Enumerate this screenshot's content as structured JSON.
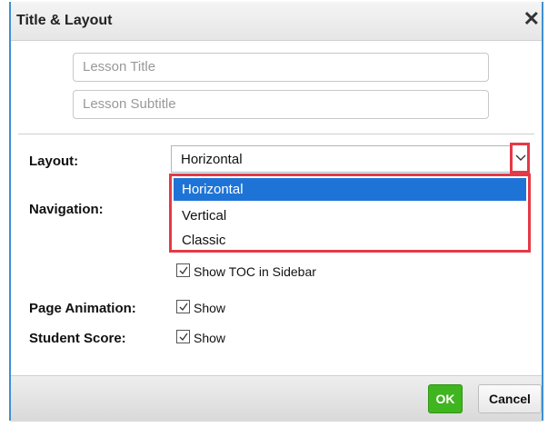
{
  "dialog": {
    "title": "Title & Layout",
    "close_icon": "close-icon"
  },
  "fields": {
    "lesson_title": {
      "value": "",
      "placeholder": "Lesson Title"
    },
    "lesson_subtitle": {
      "value": "",
      "placeholder": "Lesson Subtitle"
    }
  },
  "layout": {
    "label": "Layout:",
    "selected": "Horizontal",
    "options": [
      "Horizontal",
      "Vertical",
      "Classic"
    ]
  },
  "navigation": {
    "label": "Navigation:"
  },
  "toc": {
    "label": "Show TOC in Sidebar",
    "checked": true
  },
  "page_animation": {
    "label": "Page Animation:",
    "checkbox_label": "Show",
    "checked": true
  },
  "student_score": {
    "label": "Student Score:",
    "checkbox_label": "Show",
    "checked": true
  },
  "footer": {
    "ok_label": "OK",
    "cancel_label": "Cancel"
  },
  "colors": {
    "accent": "#1e74d6",
    "highlight": "#e53946",
    "ok": "#3fb51f",
    "frame": "#3f8fd6"
  }
}
